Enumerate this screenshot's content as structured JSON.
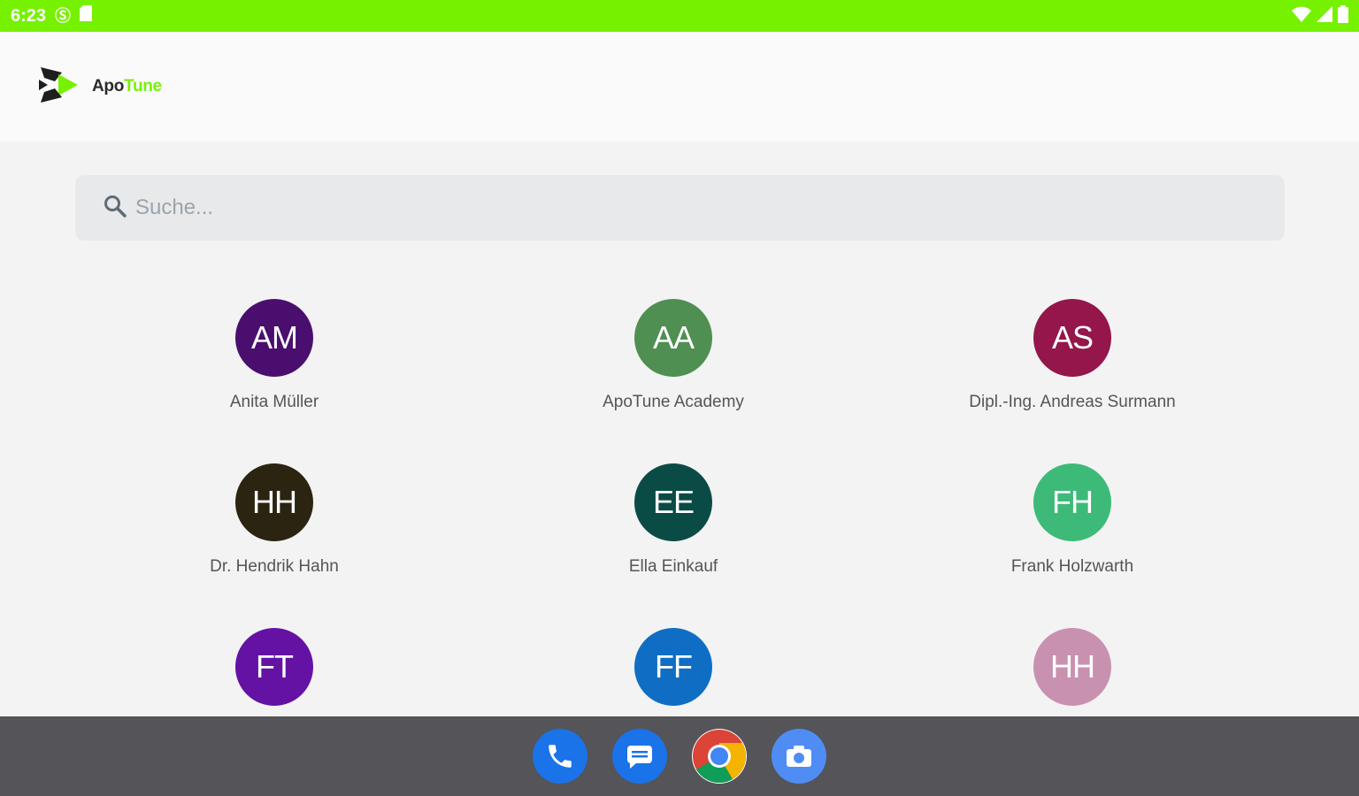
{
  "status_bar": {
    "time": "6:23",
    "left_icons": [
      "s-icon",
      "sd-card-icon"
    ],
    "right_icons": [
      "wifi-icon",
      "signal-icon",
      "battery-icon"
    ]
  },
  "header": {
    "logo_apo": "Apo",
    "logo_tune": "Tune"
  },
  "search": {
    "placeholder": "Suche..."
  },
  "contacts": [
    {
      "initials": "AM",
      "name": "Anita Müller",
      "color": "#4a0f6e"
    },
    {
      "initials": "AA",
      "name": "ApoTune Academy",
      "color": "#4f8f52"
    },
    {
      "initials": "AS",
      "name": "Dipl.-Ing. Andreas Surmann",
      "color": "#94164a"
    },
    {
      "initials": "HH",
      "name": "Dr. Hendrik Hahn",
      "color": "#2a2410"
    },
    {
      "initials": "EE",
      "name": "Ella Einkauf",
      "color": "#0b4b45"
    },
    {
      "initials": "FH",
      "name": "Frank Holzwarth",
      "color": "#3dba77"
    },
    {
      "initials": "FT",
      "name": "",
      "color": "#6412a4"
    },
    {
      "initials": "FF",
      "name": "",
      "color": "#0f6ec4"
    },
    {
      "initials": "HH",
      "name": "",
      "color": "#c991b0"
    }
  ],
  "dock": [
    {
      "icon": "phone-icon",
      "color": "#1a73e8"
    },
    {
      "icon": "messages-icon",
      "color": "#1a73e8"
    },
    {
      "icon": "chrome-icon",
      "color": "#ffffff"
    },
    {
      "icon": "camera-icon",
      "color": "#4f8df5"
    }
  ],
  "colors": {
    "accent": "#76f200",
    "background": "#f3f3f3",
    "nav_bar": "#545459"
  }
}
